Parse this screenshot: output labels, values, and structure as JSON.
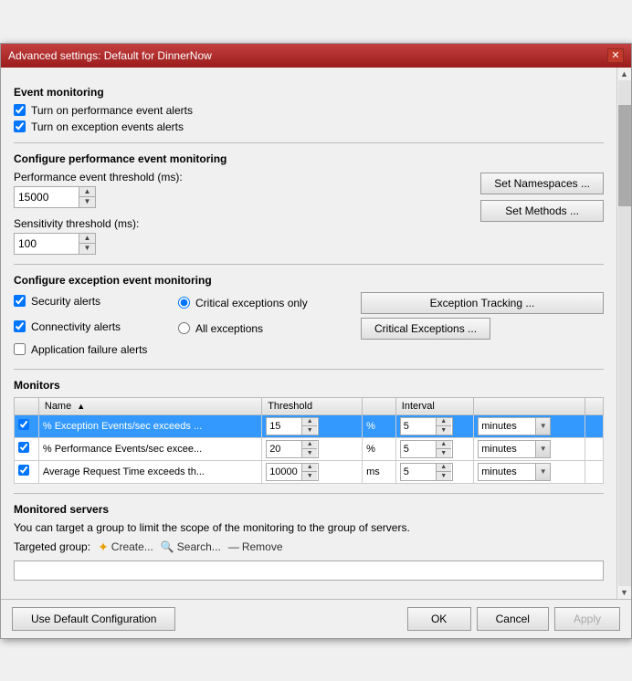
{
  "window": {
    "title": "Advanced settings: Default for DinnerNow",
    "close_label": "✕"
  },
  "event_monitoring": {
    "section_title": "Event monitoring",
    "checkbox1_label": "Turn on performance event alerts",
    "checkbox2_label": "Turn on exception events alerts",
    "checkbox1_checked": true,
    "checkbox2_checked": true
  },
  "perf_event": {
    "section_title": "Configure performance event monitoring",
    "threshold_label": "Performance event threshold (ms):",
    "threshold_value": "15000",
    "sensitivity_label": "Sensitivity threshold (ms):",
    "sensitivity_value": "100",
    "btn_namespaces": "Set Namespaces ...",
    "btn_methods": "Set Methods ..."
  },
  "exception_event": {
    "section_title": "Configure exception event monitoring",
    "checkbox_security": "Security alerts",
    "checkbox_connectivity": "Connectivity alerts",
    "checkbox_appfailure": "Application failure alerts",
    "security_checked": true,
    "connectivity_checked": true,
    "appfailure_checked": false,
    "radio_critical": "Critical exceptions only",
    "radio_all": "All exceptions",
    "btn_exception_tracking": "Exception Tracking ...",
    "btn_critical_exceptions": "Critical Exceptions ..."
  },
  "monitors": {
    "section_title": "Monitors",
    "table": {
      "col_name": "Name",
      "col_threshold": "Threshold",
      "col_interval": "Interval",
      "rows": [
        {
          "checked": true,
          "name": "% Exception Events/sec exceeds ...",
          "threshold_value": "15",
          "unit": "%",
          "interval_value": "5",
          "interval_unit": "minutes",
          "selected": true
        },
        {
          "checked": true,
          "name": "% Performance Events/sec excee...",
          "threshold_value": "20",
          "unit": "%",
          "interval_value": "5",
          "interval_unit": "minutes",
          "selected": false
        },
        {
          "checked": true,
          "name": "Average Request Time exceeds th...",
          "threshold_value": "10000",
          "unit": "ms",
          "interval_value": "5",
          "interval_unit": "minutes",
          "selected": false
        }
      ]
    }
  },
  "monitored_servers": {
    "section_title": "Monitored servers",
    "description": "You can target a group to limit the scope of the monitoring to the group of servers.",
    "targeted_group_label": "Targeted group:",
    "create_label": "Create...",
    "search_label": "Search...",
    "remove_label": "Remove"
  },
  "bottom": {
    "default_config_btn": "Use Default Configuration",
    "ok_btn": "OK",
    "cancel_btn": "Cancel",
    "apply_btn": "Apply"
  }
}
